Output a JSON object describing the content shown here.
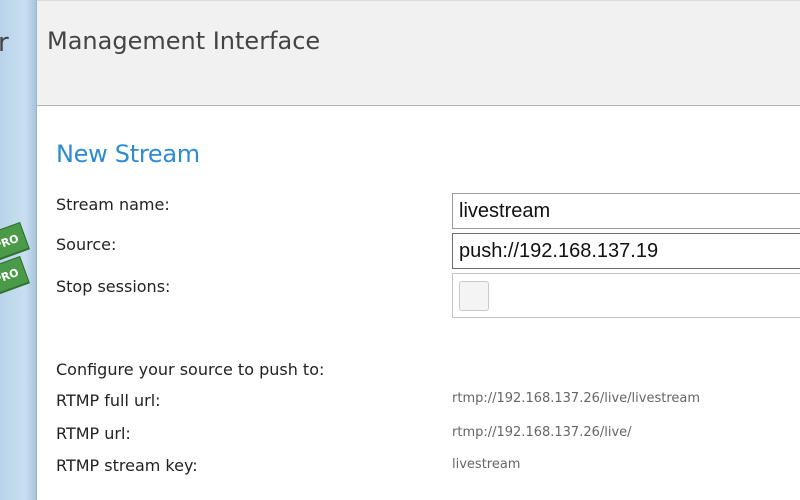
{
  "sidebar": {
    "partial_letter": "r",
    "badges": [
      "PRO",
      "PRO"
    ]
  },
  "header": {
    "title": "Management Interface"
  },
  "form": {
    "title": "New Stream",
    "stream_name_label": "Stream name:",
    "stream_name_value": "livestream",
    "source_label": "Source:",
    "source_value": "push://192.168.137.19",
    "stop_sessions_label": "Stop sessions:",
    "stop_sessions_checked": false
  },
  "push_info": {
    "heading": "Configure your source to push to:",
    "rtmp_full_url_label": "RTMP full url:",
    "rtmp_full_url_value": "rtmp://192.168.137.26/live/livestream",
    "rtmp_url_label": "RTMP url:",
    "rtmp_url_value": "rtmp://192.168.137.26/live/",
    "rtmp_stream_key_label": "RTMP stream key:",
    "rtmp_stream_key_value": "livestream"
  },
  "colors": {
    "section_title": "#2e8bd0",
    "sidebar": "#c9dff1",
    "pro_badge": "#4a9a4a"
  }
}
